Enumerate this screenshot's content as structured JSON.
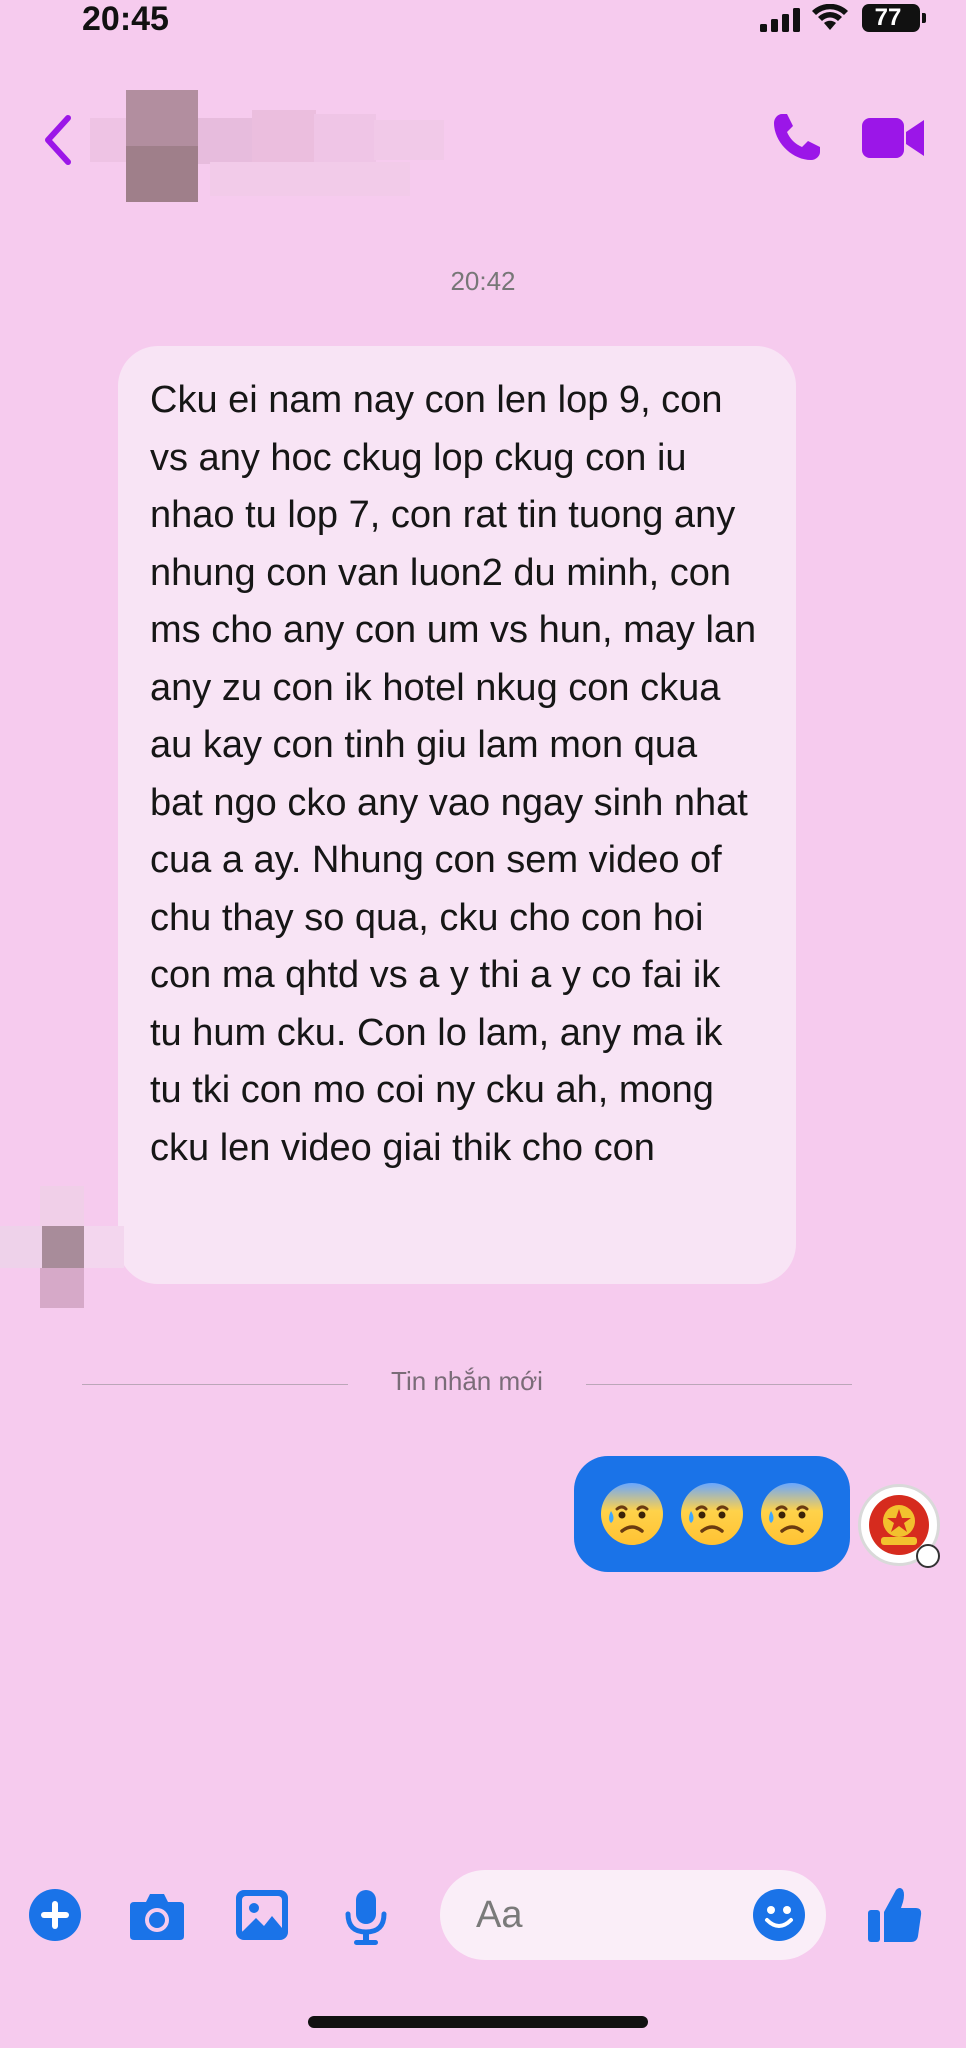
{
  "status_bar": {
    "time": "20:45",
    "battery": "77"
  },
  "header": {
    "back_icon": "chevron-left-icon",
    "call_icon": "phone-icon",
    "video_icon": "video-camera-icon",
    "accent_color": "#9b16e8"
  },
  "conversation": {
    "timestamp": "20:42",
    "incoming_message_lines": [
      "Cku ei nam nay con len lop 9, con",
      "vs any hoc ckug lop ckug con iu",
      "nhao tu lop 7, con rat tin tuong any",
      "nhung con van luon2 du minh, con",
      "ms cho any con um vs hun, may lan",
      "any zu con ik hotel nkug con ckua",
      "au kay con tinh giu lam mon qua",
      "bat ngo cko any vao ngay sinh nhat",
      "cua a ay. Nhung con sem video of",
      "chu thay so qua, cku cho con hoi",
      "con ma qhtd vs a y thi a y co fai ik",
      "tu hum cku. Con lo lam, any ma ik",
      "tu tki con mo coi ny cku ah, mong",
      "cku len video giai thik cho con"
    ],
    "divider_label": "Tin nhắn mới",
    "outgoing_emojis": [
      "😰",
      "😰",
      "😰"
    ],
    "outgoing_bubble_color": "#1a73e8"
  },
  "composer": {
    "placeholder": "Aa",
    "icons": [
      "plus-circle-icon",
      "camera-icon",
      "gallery-icon",
      "microphone-icon",
      "emoji-icon",
      "thumbs-up-icon"
    ],
    "icon_color": "#1a73e8"
  }
}
